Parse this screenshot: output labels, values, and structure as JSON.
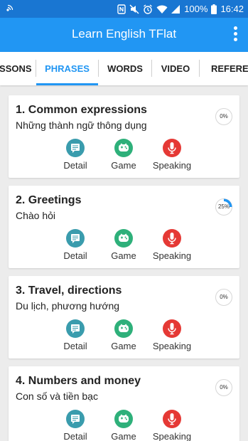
{
  "statusbar": {
    "battery": "100%",
    "time": "16:42"
  },
  "app": {
    "title": "Learn English TFlat"
  },
  "colors": {
    "primary": "#2196f3",
    "statusbar": "#1976d2",
    "detail": "#3a9cad",
    "game": "#2eb07a",
    "speaking": "#e53935"
  },
  "tabs": [
    {
      "label": "LESSONS",
      "active": false
    },
    {
      "label": "PHRASES",
      "active": true
    },
    {
      "label": "WORDS",
      "active": false
    },
    {
      "label": "VIDEO",
      "active": false
    },
    {
      "label": "REFERENCE",
      "active": false
    }
  ],
  "actions": {
    "detail": "Detail",
    "game": "Game",
    "speaking": "Speaking"
  },
  "lessons": [
    {
      "title": "1. Common expressions",
      "subtitle": "Những thành ngữ thông dụng",
      "progress_label": "0%",
      "progress": 0
    },
    {
      "title": "2. Greetings",
      "subtitle": "Chào hỏi",
      "progress_label": "25%",
      "progress": 0.25
    },
    {
      "title": "3. Travel, directions",
      "subtitle": "Du lịch, phương hướng",
      "progress_label": "0%",
      "progress": 0
    },
    {
      "title": "4. Numbers and money",
      "subtitle": "Con số và tiền bạc",
      "progress_label": "0%",
      "progress": 0
    }
  ]
}
